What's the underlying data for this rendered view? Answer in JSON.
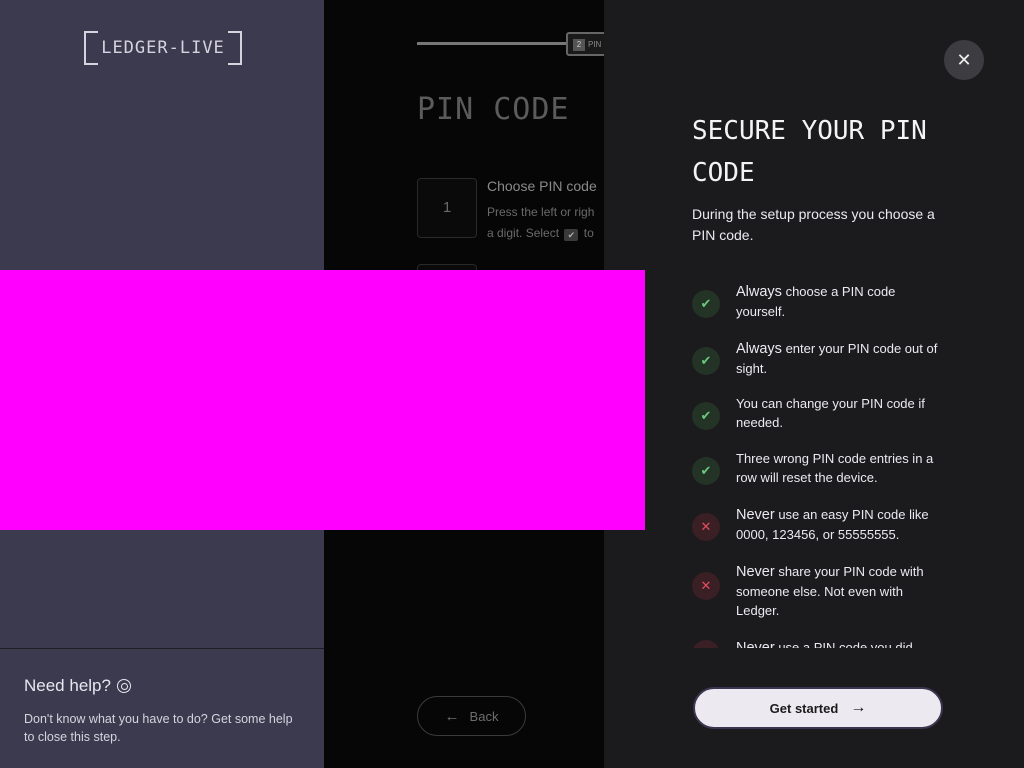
{
  "sidebar": {
    "logo_text": "LEDGER-LIVE",
    "help_title": "Need help?",
    "help_text": "Don't know what you have to do? Get some help to close this step."
  },
  "center": {
    "step_badge_num": "2",
    "step_badge_label": "PIN",
    "title": "PIN CODE",
    "step1_number": "1",
    "step1_title": "Choose PIN code",
    "step1_desc_a": "Press the left or righ",
    "step1_desc_b": "a digit. Select",
    "step1_desc_c": "to",
    "back_label": "Back"
  },
  "drawer": {
    "title": "SECURE YOUR PIN CODE",
    "intro": "During the setup process you choose a PIN code.",
    "rules": [
      {
        "type": "ok",
        "strong": "Always",
        "text": "choose a PIN code yourself."
      },
      {
        "type": "ok",
        "strong": "Always",
        "text": "enter your PIN code out of sight."
      },
      {
        "type": "ok",
        "strong": "",
        "text": "You can change your PIN code if needed."
      },
      {
        "type": "ok",
        "strong": "",
        "text": "Three wrong PIN code entries in a row will reset the device."
      },
      {
        "type": "bad",
        "strong": "Never",
        "text": "use an easy PIN code like 0000, 123456, or 55555555."
      },
      {
        "type": "bad",
        "strong": "Never",
        "text": "share your PIN code with someone else. Not even with Ledger."
      },
      {
        "type": "bad",
        "strong": "Never",
        "text": "use a PIN code you did"
      }
    ],
    "start_label": "Get started"
  },
  "icons": {
    "ok": "check-icon",
    "bad": "cross-icon",
    "close": "close-icon",
    "back": "arrow-left-icon",
    "start": "arrow-right-icon",
    "help": "help-icon"
  },
  "colors": {
    "sidebar_bg": "#3c3a4f",
    "drawer_bg": "#1b1b1d",
    "ok_green": "#6ac97d",
    "bad_red": "#e54c5f"
  }
}
